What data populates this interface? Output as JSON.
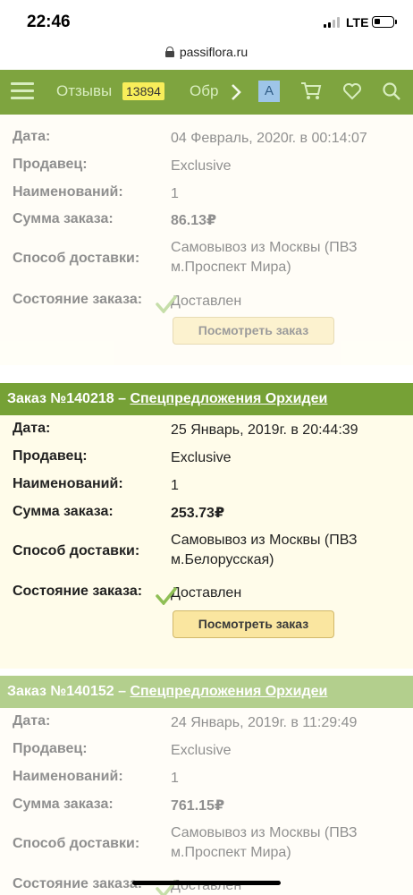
{
  "status_bar": {
    "time": "22:46",
    "network": "LTE",
    "battery_level": 0.35
  },
  "browser": {
    "url": "passiflora.ru"
  },
  "nav": {
    "reviews_label": "Отзывы",
    "reviews_count": "13894",
    "next_label": "Обр",
    "a_label": "A",
    "icons": [
      "hamburger-icon",
      "chevron-right-icon",
      "cart-icon",
      "heart-icon",
      "search-icon"
    ]
  },
  "labels": {
    "date": "Дата:",
    "seller": "Продавец:",
    "items": "Наименований:",
    "total": "Сумма заказа:",
    "delivery": "Способ доставки:",
    "status": "Состояние заказа:",
    "view_button": "Посмотреть заказ"
  },
  "orders": [
    {
      "title": "",
      "category": "",
      "date": "04 Февраль, 2020г. в 00:14:07",
      "seller": "Exclusive",
      "items": "1",
      "total": "86.13₽",
      "delivery": "Самовывоз из Москвы (ПВЗ м.Проспект Мира)",
      "status": "Доставлен"
    },
    {
      "title": "Заказ №140218 –",
      "category": "Спецпредложения Орхидеи",
      "date": "25 Январь, 2019г. в 20:44:39",
      "seller": "Exclusive",
      "items": "1",
      "total": "253.73₽",
      "delivery": "Самовывоз из Москвы (ПВЗ м.Белорусская)",
      "status": "Доставлен"
    },
    {
      "title": "Заказ №140152 –",
      "category": "Спецпредложения Орхидеи",
      "date": "24 Январь, 2019г. в 11:29:49",
      "seller": "Exclusive",
      "items": "1",
      "total": "761.15₽",
      "delivery": "Самовывоз из Москвы (ПВЗ м.Проспект Мира)",
      "status": "Доставлен"
    }
  ],
  "colors": {
    "nav_bg": "#7ea43f",
    "active_header": "#76a136",
    "faded_header": "#b3cf8d",
    "badge": "#f8ee5a",
    "button_bg": "#fae6a0",
    "check": "#8fbf55"
  }
}
